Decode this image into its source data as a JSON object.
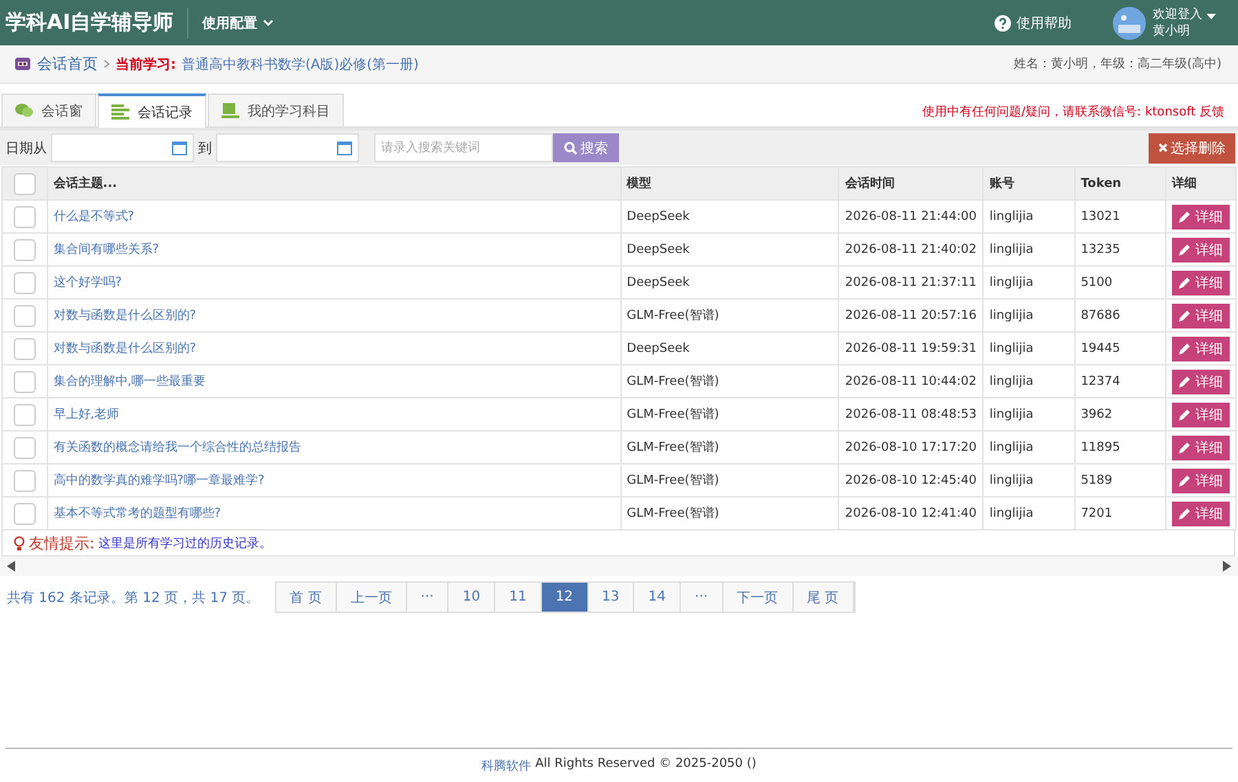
{
  "header": {
    "title": "学科AI自学辅导师",
    "menu": "使用配置",
    "help": "使用帮助",
    "welcome": "欢迎登入",
    "user": "黄小明"
  },
  "breadcrumb": {
    "home": "会话首页",
    "current_label": "当前学习:",
    "current": "普通高中教科书数学(A版)必修(第一册)",
    "info": "姓名：黄小明，年级：高二年级(高中)"
  },
  "tabs": [
    {
      "label": "会话窗",
      "selected": false
    },
    {
      "label": "会话记录",
      "selected": true
    },
    {
      "label": "我的学习科目",
      "selected": false
    }
  ],
  "notice": "使用中有任何问题/疑问，请联系微信号: ktonsoft 反馈",
  "filter": {
    "date_from": "日期从",
    "date_to": "到",
    "placeholder": "请录入搜索关键词",
    "search": "搜索",
    "delete": "选择删除"
  },
  "table": {
    "all_checked": false,
    "columns": [
      "会话主题...",
      "模型",
      "会话时间",
      "账号",
      "Token",
      "详细"
    ],
    "rows": [
      {
        "subject": "什么是不等式?",
        "model": "DeepSeek",
        "time": "2026-08-11 21:44:00",
        "account": "linglijia",
        "token": "13021",
        "action": "详细",
        "checked": false
      },
      {
        "subject": "集合间有哪些关系?",
        "model": "DeepSeek",
        "time": "2026-08-11 21:40:02",
        "account": "linglijia",
        "token": "13235",
        "action": "详细",
        "checked": false
      },
      {
        "subject": "这个好学吗?",
        "model": "DeepSeek",
        "time": "2026-08-11 21:37:11",
        "account": "linglijia",
        "token": "5100",
        "action": "详细",
        "checked": false
      },
      {
        "subject": "对数与函数是什么区别的?",
        "model": "GLM-Free(智谱)",
        "time": "2026-08-11 20:57:16",
        "account": "linglijia",
        "token": "87686",
        "action": "详细",
        "checked": false
      },
      {
        "subject": "对数与函数是什么区别的?",
        "model": "DeepSeek",
        "time": "2026-08-11 19:59:31",
        "account": "linglijia",
        "token": "19445",
        "action": "详细",
        "checked": false
      },
      {
        "subject": "集合的理解中,哪一些最重要",
        "model": "GLM-Free(智谱)",
        "time": "2026-08-11 10:44:02",
        "account": "linglijia",
        "token": "12374",
        "action": "详细",
        "checked": false
      },
      {
        "subject": "早上好,老师",
        "model": "GLM-Free(智谱)",
        "time": "2026-08-11 08:48:53",
        "account": "linglijia",
        "token": "3962",
        "action": "详细",
        "checked": false
      },
      {
        "subject": "有关函数的概念请给我一个综合性的总结报告",
        "model": "GLM-Free(智谱)",
        "time": "2026-08-10 17:17:20",
        "account": "linglijia",
        "token": "11895",
        "action": "详细",
        "checked": false
      },
      {
        "subject": "高中的数学真的难学吗?哪一章最难学?",
        "model": "GLM-Free(智谱)",
        "time": "2026-08-10 12:45:40",
        "account": "linglijia",
        "token": "5189",
        "action": "详细",
        "checked": false
      },
      {
        "subject": "基本不等式常考的题型有哪些?",
        "model": "GLM-Free(智谱)",
        "time": "2026-08-10 12:41:40",
        "account": "linglijia",
        "token": "7201",
        "action": "详细",
        "checked": false
      }
    ]
  },
  "tip": {
    "label": "友情提示:",
    "text": "这里是所有学习过的历史记录。"
  },
  "pagination": {
    "summary": "共有 162 条记录。第 12 页，共 17 页。",
    "pages": [
      {
        "label": "首 页",
        "selected": false
      },
      {
        "label": "上一页",
        "selected": false
      },
      {
        "label": "···",
        "selected": false
      },
      {
        "label": "10",
        "selected": false
      },
      {
        "label": "11",
        "selected": false
      },
      {
        "label": "12",
        "selected": true
      },
      {
        "label": "13",
        "selected": false
      },
      {
        "label": "14",
        "selected": false
      },
      {
        "label": "···",
        "selected": false
      },
      {
        "label": "下一页",
        "selected": false
      },
      {
        "label": "尾 页",
        "selected": false
      }
    ]
  },
  "footer": {
    "company": "科腾软件",
    "rights": "All Rights Reserved © 2025-2050 ()"
  }
}
